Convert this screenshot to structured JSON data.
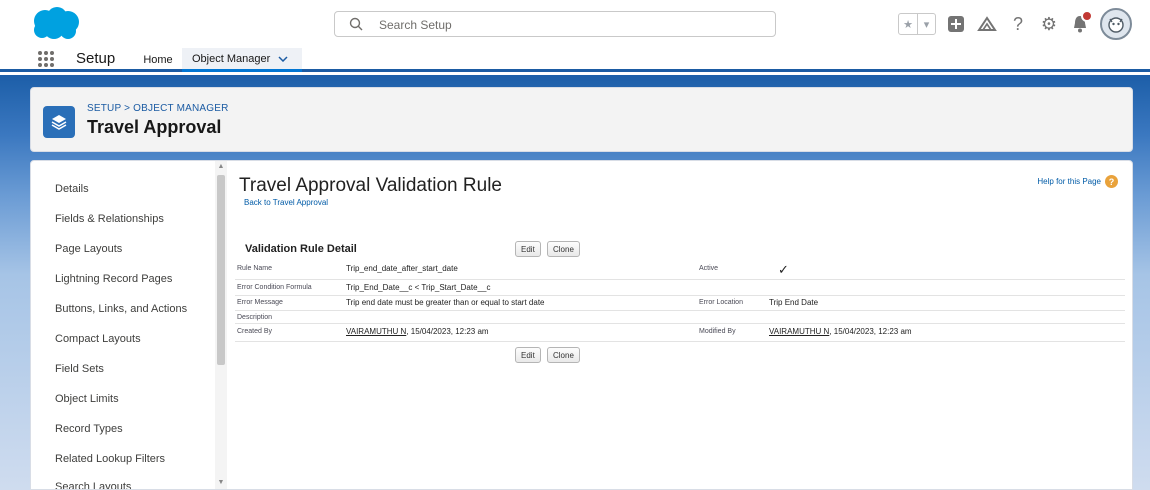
{
  "header": {
    "search_placeholder": "Search Setup",
    "help_icon": "?",
    "gear_icon": "⚙"
  },
  "nav": {
    "app_name": "Setup",
    "tabs": [
      {
        "label": "Home"
      },
      {
        "label": "Object Manager"
      }
    ]
  },
  "page_header": {
    "breadcrumb": "SETUP > OBJECT MANAGER",
    "title": "Travel Approval"
  },
  "sidebar": {
    "items": [
      "Details",
      "Fields & Relationships",
      "Page Layouts",
      "Lightning Record Pages",
      "Buttons, Links, and Actions",
      "Compact Layouts",
      "Field Sets",
      "Object Limits",
      "Record Types",
      "Related Lookup Filters",
      "Search Layouts"
    ]
  },
  "content": {
    "title": "Travel Approval Validation Rule",
    "back_link": "Back to Travel Approval",
    "help_link": "Help for this Page",
    "section_title": "Validation Rule Detail",
    "edit_label": "Edit",
    "clone_label": "Clone",
    "details": {
      "rule_name_label": "Rule Name",
      "rule_name": "Trip_end_date_after_start_date",
      "active_label": "Active",
      "active_check": "✓",
      "formula_label": "Error Condition Formula",
      "formula": "Trip_End_Date__c < Trip_Start_Date__c",
      "error_message_label": "Error Message",
      "error_message": "Trip end date must be greater than or equal to start date",
      "error_location_label": "Error Location",
      "error_location": "Trip End Date",
      "description_label": "Description",
      "created_by_label": "Created By",
      "created_by_user": "VAIRAMUTHU N",
      "created_by_date": ", 15/04/2023, 12:23 am",
      "modified_by_label": "Modified By",
      "modified_by_user": "VAIRAMUTHU N",
      "modified_by_date": ", 15/04/2023, 12:23 am"
    }
  },
  "colors": {
    "brand_blue": "#1b5ba3",
    "link": "#015ba7",
    "cloud": "#00a1e0"
  }
}
